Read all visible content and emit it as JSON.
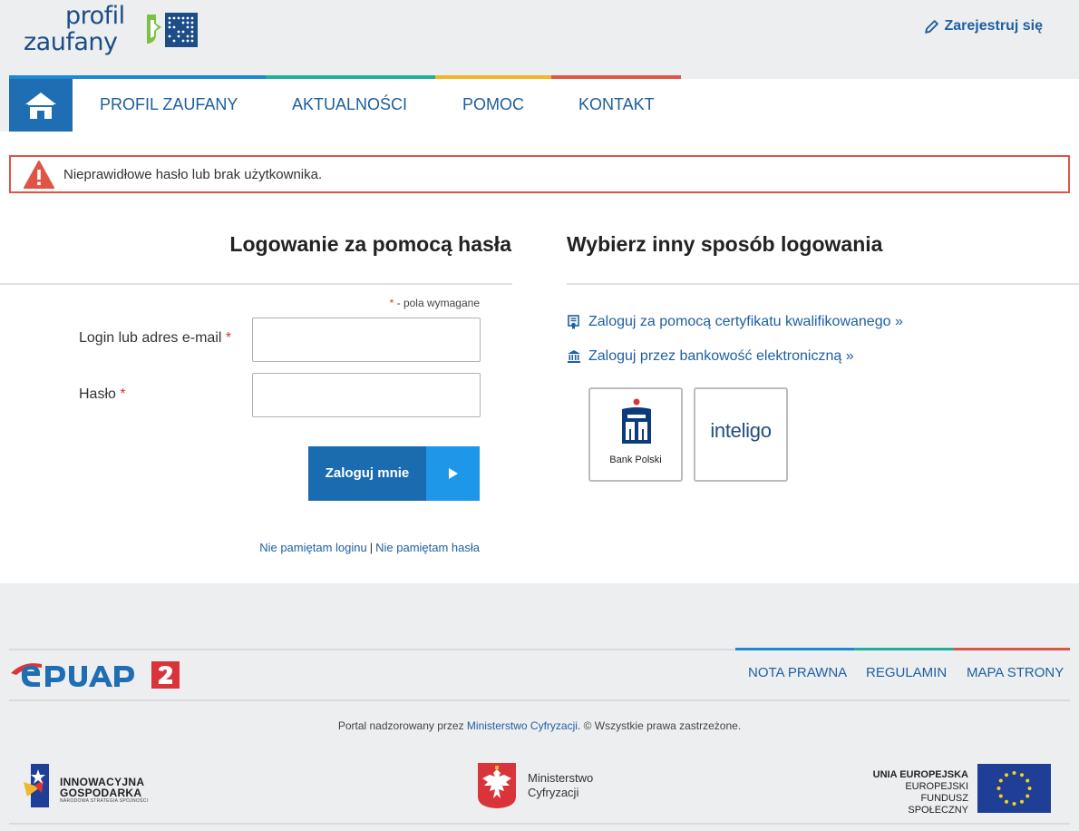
{
  "header": {
    "logo_line1": "profil",
    "logo_line2": "zaufany",
    "register_label": "Zarejestruj się"
  },
  "nav": {
    "items": [
      {
        "label": "PROFIL ZAUFANY"
      },
      {
        "label": "AKTUALNOŚCI"
      },
      {
        "label": "POMOC"
      },
      {
        "label": "KONTAKT"
      }
    ],
    "stripe_colors": [
      "#1e88d2",
      "#1fb09a",
      "#f0b72a",
      "#e05446"
    ]
  },
  "alert": {
    "message": "Nieprawidłowe hasło lub brak użytkownika.",
    "color": "#e05446"
  },
  "login": {
    "heading": "Logowanie za pomocą hasła",
    "required_star": "*",
    "required_note": " - pola wymagane",
    "login_label": "Login lub adres e-mail",
    "login_value": "",
    "password_label": "Hasło",
    "password_value": "",
    "submit_label": "Zaloguj mnie",
    "forgot_login": "Nie pamiętam loginu",
    "forgot_separator": "|",
    "forgot_password": "Nie pamiętam hasła"
  },
  "alternatives": {
    "heading": "Wybierz inny sposób logowania",
    "certificate_link": "Zaloguj za pomocą certyfikatu kwalifikowanego »",
    "bank_link": "Zaloguj przez bankowość elektroniczną »",
    "banks": [
      {
        "caption": "Bank Polski",
        "icon": "pko-bp-logo"
      },
      {
        "caption": "inteligo",
        "icon": "inteligo-logo"
      }
    ]
  },
  "footer": {
    "links": [
      {
        "label": "NOTA PRAWNA"
      },
      {
        "label": "REGULAMIN"
      },
      {
        "label": "MAPA STRONY"
      }
    ],
    "copyright_prefix": "Portal nadzorowany przez ",
    "copyright_ministry": "Ministerstwo Cyfryzacji",
    "copyright_suffix": ". © Wszystkie prawa zastrzeżone.",
    "logos": {
      "ig_line1": "INNOWACYJNA",
      "ig_line2": "GOSPODARKA",
      "ig_sub": "NARODOWA STRATEGIA SPÓJNOŚCI",
      "mc_line1": "Ministerstwo",
      "mc_line2": "Cyfryzacji",
      "eu_line1": "UNIA EUROPEJSKA",
      "eu_line2": "EUROPEJSKI",
      "eu_line3": "FUNDUSZ SPOŁECZNY"
    }
  },
  "colors": {
    "brand_blue": "#1f6eb3",
    "link_blue": "#1f5fa3",
    "button_dark": "#1b6bb0",
    "button_light": "#1e97e8",
    "required_red": "#d9343a"
  }
}
